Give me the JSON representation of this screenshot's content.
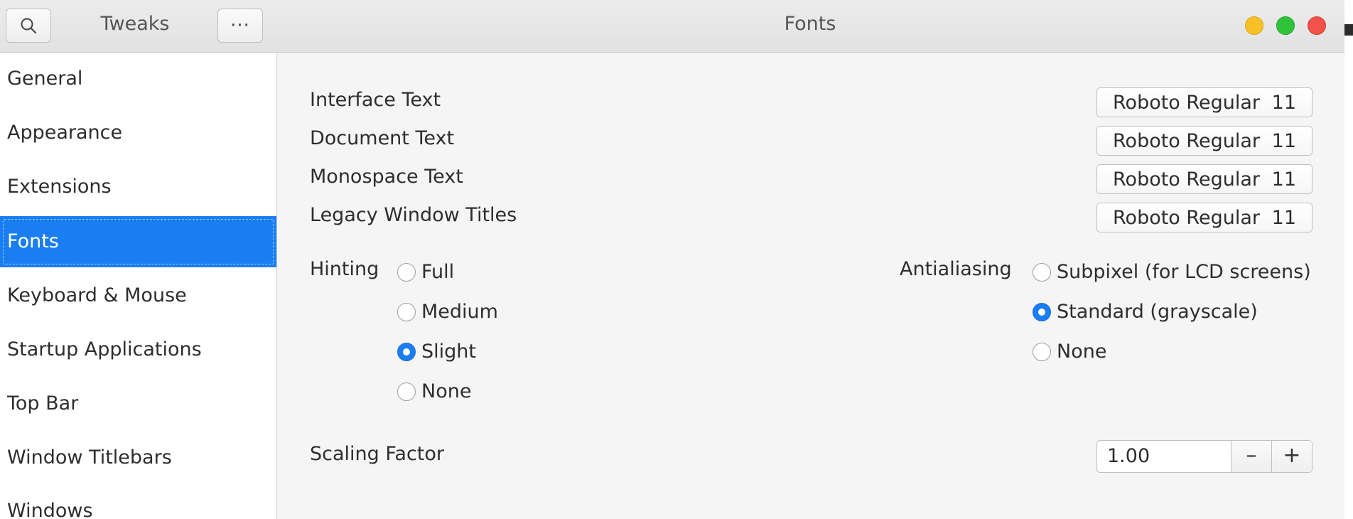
{
  "header": {
    "app_title": "Tweaks",
    "page_title": "Fonts",
    "menu_label": "···"
  },
  "sidebar": {
    "items": [
      {
        "label": "General",
        "selected": false
      },
      {
        "label": "Appearance",
        "selected": false
      },
      {
        "label": "Extensions",
        "selected": false
      },
      {
        "label": "Fonts",
        "selected": true
      },
      {
        "label": "Keyboard & Mouse",
        "selected": false
      },
      {
        "label": "Startup Applications",
        "selected": false
      },
      {
        "label": "Top Bar",
        "selected": false
      },
      {
        "label": "Window Titlebars",
        "selected": false
      },
      {
        "label": "Windows",
        "selected": false
      }
    ]
  },
  "fonts": {
    "rows": [
      {
        "label": "Interface Text",
        "font": "Roboto Regular",
        "size": "11"
      },
      {
        "label": "Document Text",
        "font": "Roboto Regular",
        "size": "11"
      },
      {
        "label": "Monospace Text",
        "font": "Roboto Regular",
        "size": "11"
      },
      {
        "label": "Legacy Window Titles",
        "font": "Roboto Regular",
        "size": "11"
      }
    ]
  },
  "hinting": {
    "label": "Hinting",
    "options": [
      "Full",
      "Medium",
      "Slight",
      "None"
    ],
    "selected": "Slight"
  },
  "antialiasing": {
    "label": "Antialiasing",
    "options": [
      "Subpixel (for LCD screens)",
      "Standard (grayscale)",
      "None"
    ],
    "selected": "Standard (grayscale)"
  },
  "scaling": {
    "label": "Scaling Factor",
    "value": "1.00",
    "decrement": "–",
    "increment": "+"
  },
  "colors": {
    "accent": "#1a7ef2",
    "close": "#f2524a",
    "minimize": "#f6c026",
    "maximize": "#2fc33b"
  }
}
